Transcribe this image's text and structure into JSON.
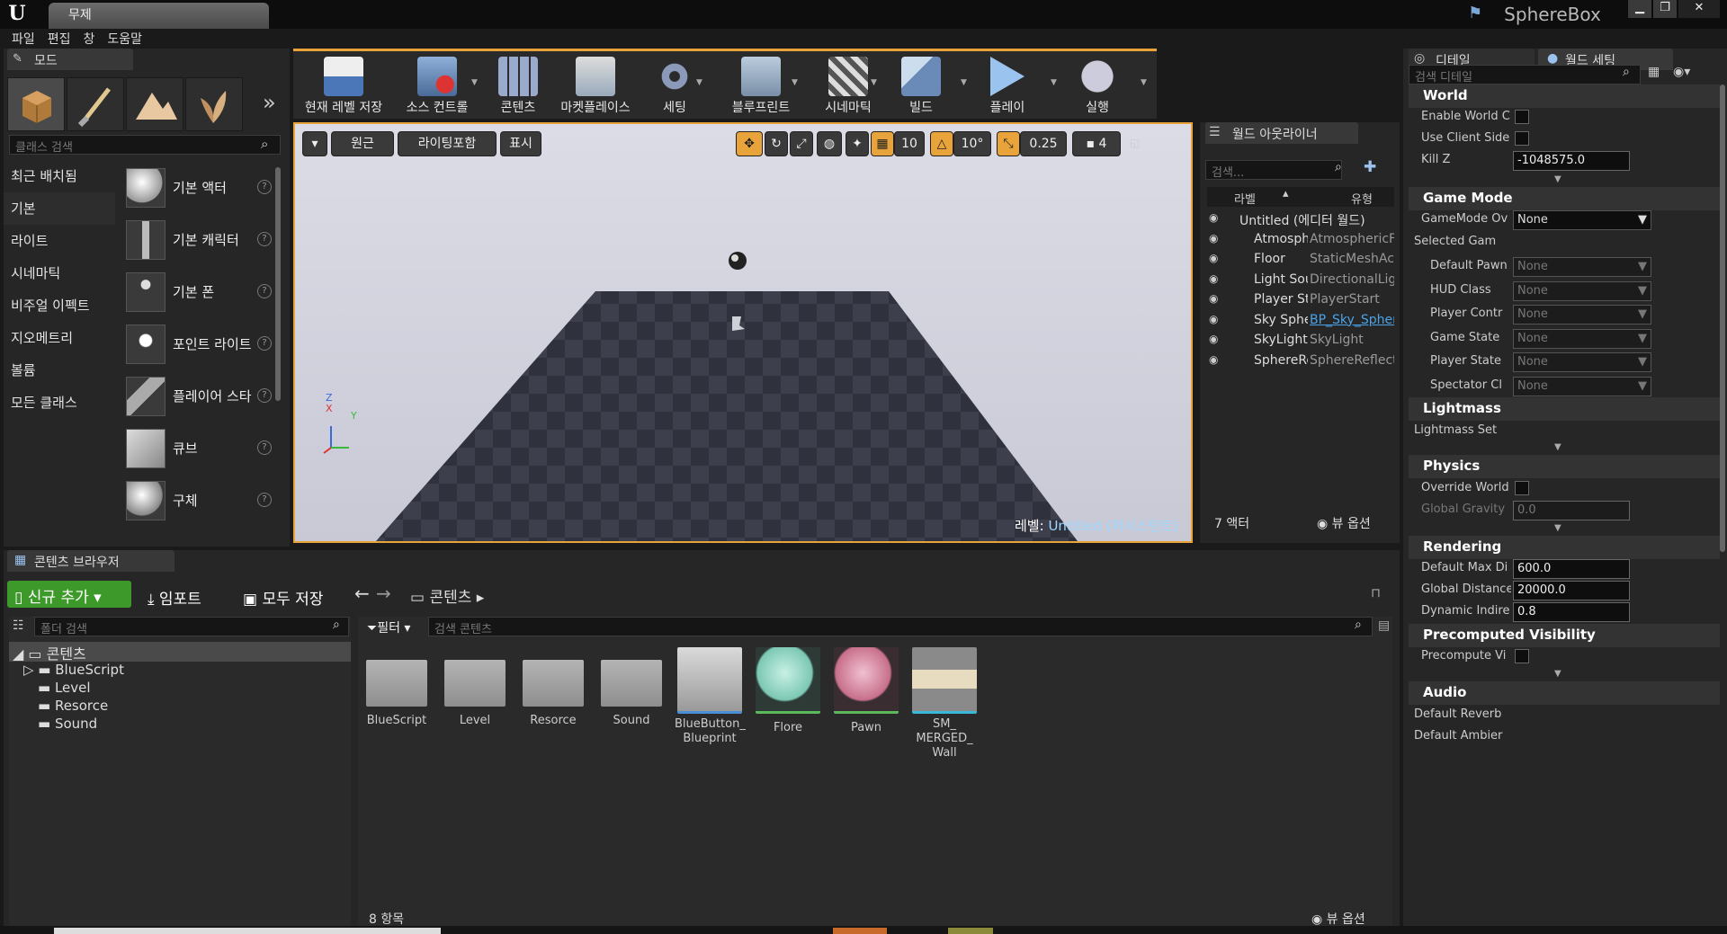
{
  "titlebar": {
    "doc_tab": "무제",
    "project": "SphereBox",
    "min": "▁",
    "max": "❐",
    "close": "✕"
  },
  "menu": [
    "파일",
    "편집",
    "창",
    "도움말"
  ],
  "modes": {
    "tab": "모드",
    "search_placeholder": "클래스 검색",
    "categories": [
      "최근 배치됨",
      "기본",
      "라이트",
      "시네마틱",
      "비주얼 이펙트",
      "지오메트리",
      "볼륨",
      "모든 클래스"
    ],
    "items": [
      "기본 액터",
      "기본 캐릭터",
      "기본 폰",
      "포인트 라이트",
      "플레이어 스타트",
      "큐브",
      "구체"
    ]
  },
  "toolbar": {
    "buttons": [
      "현재 레벨 저장",
      "소스 컨트롤",
      "콘텐츠",
      "마켓플레이스",
      "세팅",
      "블루프린트",
      "시네마틱",
      "빌드",
      "플레이",
      "실행"
    ]
  },
  "viewport": {
    "perspective": "원근",
    "lit": "라이팅포함",
    "show": "표시",
    "grid": "10",
    "rotation": "10°",
    "scale": "0.25",
    "camera_speed": "4",
    "level_label": "레벨:",
    "level_name": "Untitled (퍼시스턴트)",
    "axis_z": "Z",
    "axis_x": "X",
    "axis_y": "Y"
  },
  "outliner": {
    "tab": "월드 아웃라이너",
    "search_placeholder": "검색...",
    "col_label": "라벨",
    "col_type": "유형",
    "rows": [
      {
        "label": "Untitled (에디터 월드)",
        "type": ""
      },
      {
        "label": "AtmosphericFog",
        "type": "AtmosphericFog"
      },
      {
        "label": "Floor",
        "type": "StaticMeshActor"
      },
      {
        "label": "Light Source",
        "type": "DirectionalLight"
      },
      {
        "label": "Player Start",
        "type": "PlayerStart"
      },
      {
        "label": "Sky Sphere",
        "type": "BP_Sky_Sphere"
      },
      {
        "label": "SkyLight",
        "type": "SkyLight"
      },
      {
        "label": "SphereReflectionCapture",
        "type": "SphereReflectionCapture"
      }
    ],
    "count": "7 액터",
    "view_options": "뷰 옵션"
  },
  "details": {
    "tab_details": "디테일",
    "tab_world": "월드 세팅",
    "search_placeholder": "검색 디테일",
    "world": {
      "title": "World",
      "enable_world_c": "Enable World C",
      "use_client_side": "Use Client Side",
      "kill_z_label": "Kill Z",
      "kill_z": "-1048575.0"
    },
    "game_mode": {
      "title": "Game Mode",
      "override_label": "GameMode Ov",
      "override": "None",
      "selected": "Selected Gam",
      "rows": [
        {
          "label": "Default Pawn",
          "value": "None"
        },
        {
          "label": "HUD Class",
          "value": "None"
        },
        {
          "label": "Player Contr",
          "value": "None"
        },
        {
          "label": "Game State",
          "value": "None"
        },
        {
          "label": "Player State",
          "value": "None"
        },
        {
          "label": "Spectator Cl",
          "value": "None"
        }
      ]
    },
    "lightmass": {
      "title": "Lightmass",
      "settings": "Lightmass Set"
    },
    "physics": {
      "title": "Physics",
      "override": "Override World",
      "gravity_label": "Global Gravity",
      "gravity": "0.0"
    },
    "rendering": {
      "title": "Rendering",
      "max_draw_label": "Default Max Di",
      "max_draw": "600.0",
      "global_dist_label": "Global Distance",
      "global_dist": "20000.0",
      "dynamic_label": "Dynamic Indire",
      "dynamic": "0.8"
    },
    "precomputed": {
      "title": "Precomputed Visibility",
      "label": "Precompute Vi"
    },
    "audio": {
      "title": "Audio",
      "reverb": "Default Reverb",
      "ambient": "Default Ambier"
    }
  },
  "content_browser": {
    "tab": "콘텐츠 브라우저",
    "add_new": "신규 추가",
    "import": "임포트",
    "save_all": "모두 저장",
    "path": "콘텐츠",
    "folder_search": "폴더 검색",
    "filter": "필터",
    "content_search": "검색 콘텐츠",
    "tree_root": "콘텐츠",
    "tree": [
      "BlueScript",
      "Level",
      "Resorce",
      "Sound"
    ],
    "assets": [
      "BlueScript",
      "Level",
      "Resorce",
      "Sound",
      "BlueButton_ Blueprint",
      "Flore",
      "Pawn",
      "SM_ MERGED_ Wall"
    ],
    "count": "8 항목",
    "view_options": "뷰 옵션"
  },
  "colors": {
    "accent": "#e8a33a",
    "add_new": "#3d9a2a",
    "link": "#4aa3e8"
  }
}
